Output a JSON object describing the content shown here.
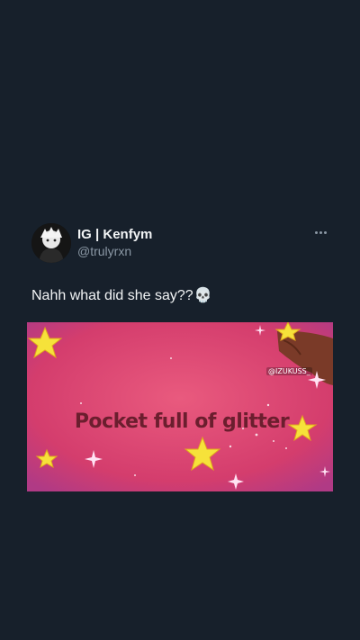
{
  "tweet": {
    "display_name": "IG | Kenfym",
    "handle": "@trulyrxn",
    "text": "Nahh what did she say??",
    "emoji": "💀",
    "more_icon": "more-dots-icon"
  },
  "media": {
    "caption": "Pocket full of glitter",
    "watermark": "@IZUKUSS_",
    "background": "#d8436f",
    "star_color": "#f6e23a"
  }
}
